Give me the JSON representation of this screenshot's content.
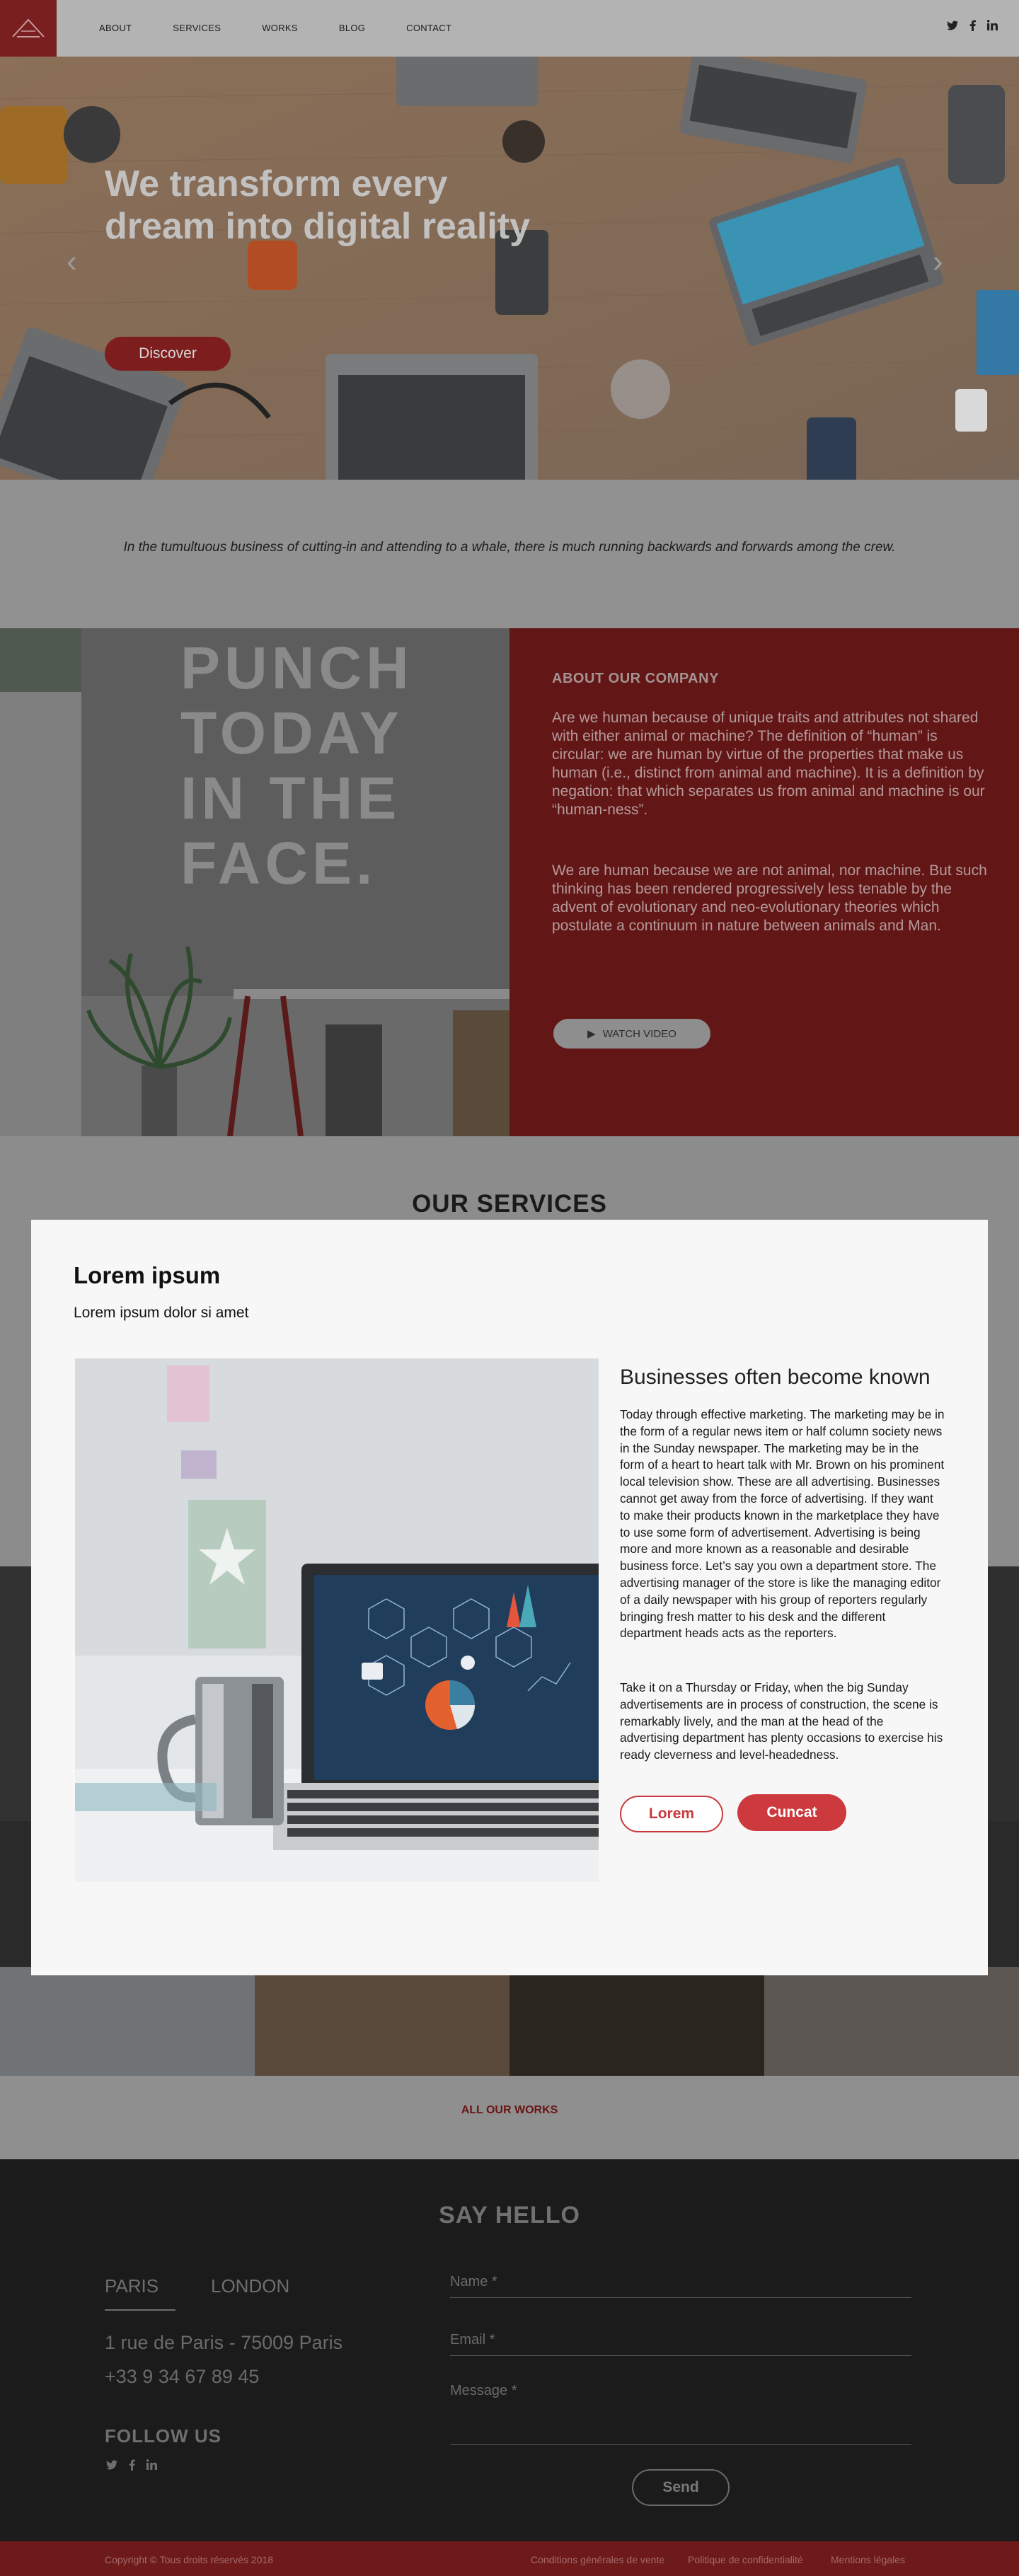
{
  "nav": {
    "items": [
      "ABOUT",
      "SERVICES",
      "WORKS",
      "BLOG",
      "CONTACT"
    ],
    "social_icons": [
      "twitter-icon",
      "facebook-icon",
      "linkedin-icon"
    ]
  },
  "hero": {
    "title": "We transform every dream into digital reality",
    "button": "Discover"
  },
  "intro": {
    "quote": "In the tumultuous business of cutting-in and attending to a whale, there is much running backwards and forwards among the crew."
  },
  "about": {
    "image_text": "PUNCH TODAY IN THE FACE.",
    "heading": "ABOUT OUR COMPANY",
    "para1": "Are we human because of unique traits and attributes not shared with either animal or machine? The definition of “human” is circular: we are human by virtue of the properties that make us human (i.e., distinct from animal and machine). It is a definition by negation: that which separates us from animal and machine is our “human-ness”.",
    "para2": "We are human because we are not animal, nor machine. But such thinking has been rendered progressively less tenable by the advent of evolutionary and neo-evolutionary theories which postulate a continuum in nature between animals and Man.",
    "watch_video": "WATCH VIDEO"
  },
  "services": {
    "heading": "OUR SERVICES"
  },
  "works": {
    "all_works": "ALL OUR WORKS"
  },
  "modal": {
    "title": "Lorem ipsum",
    "subtitle": "Lorem ipsum dolor si amet",
    "heading": "Businesses often become known",
    "para1": "Today through effective marketing. The marketing may be in the form of a regular news item or half column society news in the Sunday newspaper. The marketing may be in the form of a heart to heart talk with Mr. Brown on his prominent local television show. These are all advertising. Businesses cannot get away from the force of advertising. If they want to make their products known in the marketplace they have to use some form of advertisement. Advertising is being more and more known as a reasonable and desirable business force. Let’s say you own a department store. The advertising manager of the store is like the managing editor of a daily newspaper with his group of reporters regularly bringing fresh matter to his desk and the different department heads acts as the reporters.",
    "para2": "Take it on a Thursday or Friday, when the big Sunday advertisements are in process of construction, the scene is remarkably lively, and the man at the head of the advertising department has plenty occasions to exercise his ready cleverness and level-headedness.",
    "btn_outline": "Lorem",
    "btn_fill": "Cuncat"
  },
  "footer": {
    "heading": "SAY HELLO",
    "city_active": "PARIS",
    "city_other": "LONDON",
    "address": "1 rue de Paris  - 75009 Paris",
    "phone": "+33 9 34 67 89 45",
    "follow": "FOLLOW US",
    "name_placeholder": "Name *",
    "email_placeholder": "Email *",
    "message_placeholder": "Message *",
    "send": "Send",
    "copyright": "Copyright © Tous droits réservés 2018",
    "links": [
      "Conditions générales de vente",
      "Politique de confidentialité",
      "Mentions légales"
    ]
  },
  "colors": {
    "accent": "#cd3a3e",
    "about_bg": "#621616",
    "footer_bg": "#1b1b1b"
  }
}
